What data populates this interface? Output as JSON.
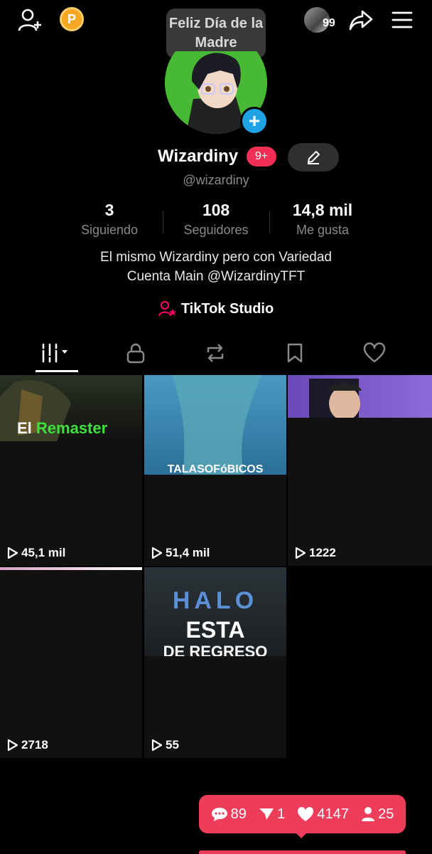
{
  "top_bar": {
    "coin_label": "P",
    "tooltip": "Feliz Día de la Madre",
    "inbox_count": "99"
  },
  "profile": {
    "display_name": "Wizardiny",
    "badge": "9+",
    "handle": "@wizardiny"
  },
  "stats": [
    {
      "value": "3",
      "label": "Siguiendo"
    },
    {
      "value": "108",
      "label": "Seguidores"
    },
    {
      "value": "14,8 mil",
      "label": "Me gusta"
    }
  ],
  "bio": {
    "line1": "El mismo Wizardiny pero con Variedad",
    "line2": "Cuenta Main @WizardinyTFT"
  },
  "studio_link": "TikTok Studio",
  "tabs": [
    "videos-grid",
    "private",
    "reposts",
    "favorites",
    "liked"
  ],
  "videos": [
    {
      "views": "45,1 mil",
      "caption_a": "El ",
      "caption_b": "Remaster"
    },
    {
      "views": "51,4 mil",
      "caption": "TALASOFóBICOS"
    },
    {
      "views": "1222"
    },
    {
      "views": "2718"
    },
    {
      "views": "55",
      "caption_logo": "HALO",
      "caption_line1": "ESTA",
      "caption_line2": "DE REGRESO"
    }
  ],
  "live_stats": {
    "comments": "89",
    "shares": "1",
    "likes": "4147",
    "viewers": "25"
  }
}
